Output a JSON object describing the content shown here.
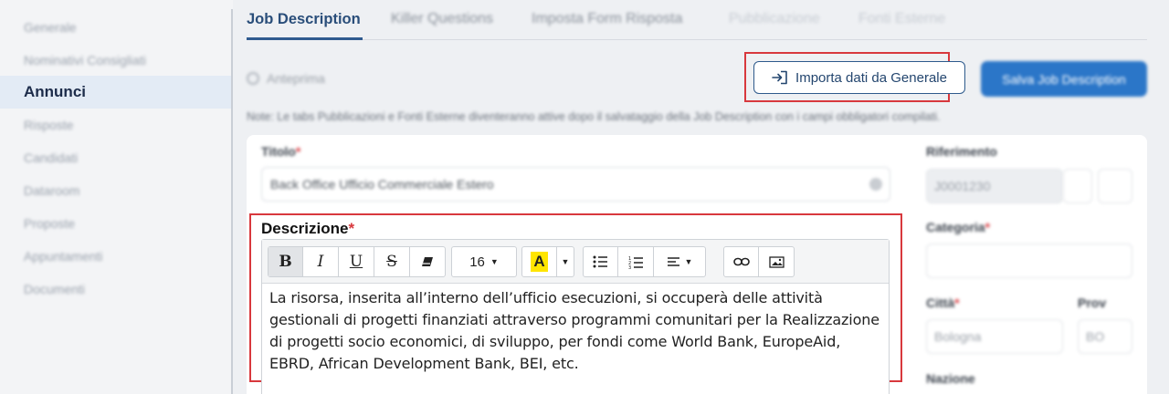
{
  "sidebar": {
    "items": [
      {
        "label": "Generale"
      },
      {
        "label": "Nominativi Consigliati"
      },
      {
        "label": "Annunci"
      },
      {
        "label": "Risposte"
      },
      {
        "label": "Candidati"
      },
      {
        "label": "Dataroom"
      },
      {
        "label": "Proposte"
      },
      {
        "label": "Appuntamenti"
      },
      {
        "label": "Documenti"
      }
    ]
  },
  "tabs": [
    {
      "label": "Job Description"
    },
    {
      "label": "Killer Questions"
    },
    {
      "label": "Imposta Form Risposta"
    },
    {
      "label": "Pubblicazione"
    },
    {
      "label": "Fonti Esterne"
    }
  ],
  "actions": {
    "preview_label": "Anteprima",
    "import_label": "Importa dati da Generale",
    "save_label": "Salva Job Description"
  },
  "note": "Note: Le tabs Pubblicazioni e Fonti Esterne diventeranno attive dopo il salvataggio della Job Description con i campi obbligatori compilati.",
  "form": {
    "titolo_label": "Titolo",
    "titolo_value": "Back Office Ufficio Commerciale Estero",
    "descrizione_label": "Descrizione",
    "required_mark": "*",
    "font_size": "16",
    "description_text": "La risorsa, inserita all’interno dell’ufficio esecuzioni, si occuperà delle attività gestionali di progetti finanziati attraverso programmi comunitari per la Realizzazione di progetti socio economici, di sviluppo, per fondi come World Bank, EuropeAid, EBRD, African Development Bank, BEI, etc.",
    "riferimento_label": "Riferimento",
    "riferimento_value": "J0001230",
    "categoria_label": "Categoria",
    "citta_label": "Città",
    "citta_value": "Bologna",
    "prov_label": "Prov",
    "prov_value": "BO",
    "nazione_label": "Nazione"
  },
  "colors": {
    "accent": "#2f5a8f",
    "highlight_border": "#d8383d",
    "save_button": "#2b76c8"
  }
}
